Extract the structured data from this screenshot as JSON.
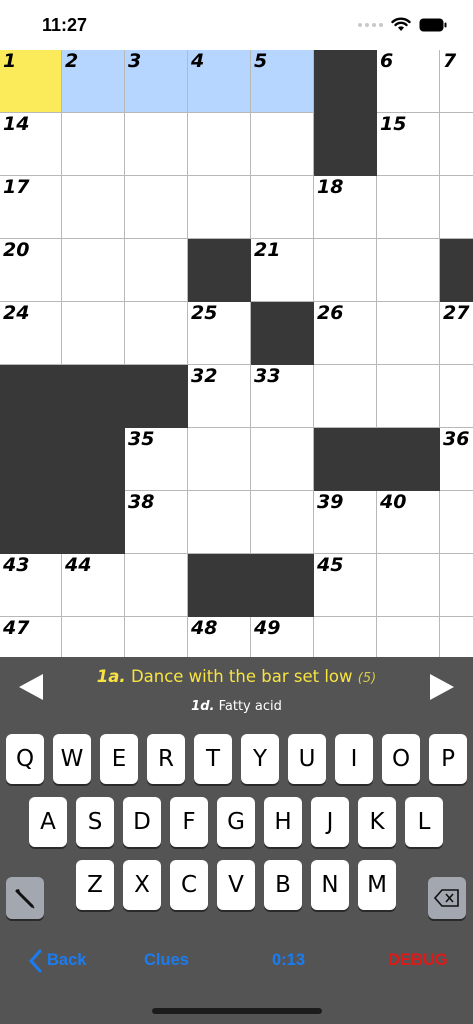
{
  "status_bar": {
    "time": "11:27"
  },
  "grid": {
    "cols": 8,
    "rows": 10,
    "black": [
      [
        0,
        5
      ],
      [
        1,
        5
      ],
      [
        3,
        3
      ],
      [
        3,
        7
      ],
      [
        4,
        4
      ],
      [
        5,
        0
      ],
      [
        5,
        1
      ],
      [
        5,
        2
      ],
      [
        6,
        0
      ],
      [
        6,
        1
      ],
      [
        6,
        5
      ],
      [
        6,
        6
      ],
      [
        7,
        0
      ],
      [
        7,
        1
      ],
      [
        8,
        3
      ],
      [
        8,
        4
      ]
    ],
    "current": [
      [
        0,
        0
      ]
    ],
    "word": [
      [
        0,
        1
      ],
      [
        0,
        2
      ],
      [
        0,
        3
      ],
      [
        0,
        4
      ]
    ],
    "numbers": [
      {
        "r": 0,
        "c": 0,
        "n": "1"
      },
      {
        "r": 0,
        "c": 1,
        "n": "2"
      },
      {
        "r": 0,
        "c": 2,
        "n": "3"
      },
      {
        "r": 0,
        "c": 3,
        "n": "4"
      },
      {
        "r": 0,
        "c": 4,
        "n": "5"
      },
      {
        "r": 0,
        "c": 6,
        "n": "6"
      },
      {
        "r": 0,
        "c": 7,
        "n": "7"
      },
      {
        "r": 1,
        "c": 0,
        "n": "14"
      },
      {
        "r": 1,
        "c": 6,
        "n": "15"
      },
      {
        "r": 2,
        "c": 0,
        "n": "17"
      },
      {
        "r": 2,
        "c": 5,
        "n": "18"
      },
      {
        "r": 3,
        "c": 0,
        "n": "20"
      },
      {
        "r": 3,
        "c": 4,
        "n": "21"
      },
      {
        "r": 4,
        "c": 0,
        "n": "24"
      },
      {
        "r": 4,
        "c": 3,
        "n": "25"
      },
      {
        "r": 4,
        "c": 5,
        "n": "26"
      },
      {
        "r": 4,
        "c": 7,
        "n": "27"
      },
      {
        "r": 5,
        "c": 3,
        "n": "32"
      },
      {
        "r": 5,
        "c": 4,
        "n": "33"
      },
      {
        "r": 6,
        "c": 2,
        "n": "35"
      },
      {
        "r": 6,
        "c": 7,
        "n": "36"
      },
      {
        "r": 7,
        "c": 2,
        "n": "38"
      },
      {
        "r": 7,
        "c": 5,
        "n": "39"
      },
      {
        "r": 7,
        "c": 6,
        "n": "40"
      },
      {
        "r": 8,
        "c": 0,
        "n": "43"
      },
      {
        "r": 8,
        "c": 1,
        "n": "44"
      },
      {
        "r": 8,
        "c": 5,
        "n": "45"
      },
      {
        "r": 9,
        "c": 0,
        "n": "47"
      },
      {
        "r": 9,
        "c": 3,
        "n": "48"
      },
      {
        "r": 9,
        "c": 4,
        "n": "49"
      }
    ]
  },
  "clue": {
    "current_number": "1a.",
    "current_text": "Dance with the bar set low",
    "current_length": "(5)",
    "cross_number": "1d.",
    "cross_text": "Fatty acid"
  },
  "keyboard": {
    "row1": [
      "Q",
      "W",
      "E",
      "R",
      "T",
      "Y",
      "U",
      "I",
      "O",
      "P"
    ],
    "row2": [
      "A",
      "S",
      "D",
      "F",
      "G",
      "H",
      "J",
      "K",
      "L"
    ],
    "row3": [
      "Z",
      "X",
      "C",
      "V",
      "B",
      "N",
      "M"
    ],
    "pencil_icon": "pencil-icon",
    "delete_icon": "backspace-icon"
  },
  "toolbar": {
    "back": "Back",
    "clues": "Clues",
    "timer": "0:13",
    "debug": "DEBUG",
    "accent": "#1b7cf2",
    "debug_color": "#e01818"
  }
}
